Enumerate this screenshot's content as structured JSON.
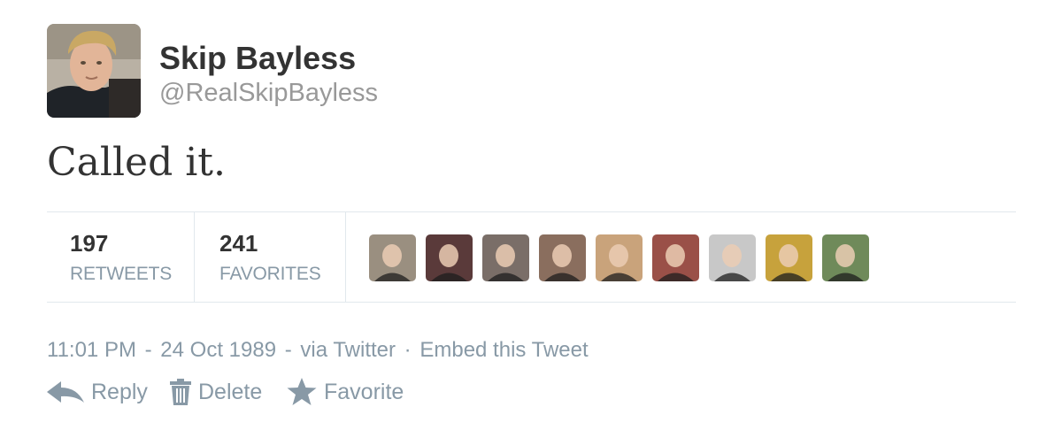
{
  "user": {
    "name": "Skip Bayless",
    "screen_name": "@RealSkipBayless"
  },
  "tweet": {
    "text": "Called it."
  },
  "stats": {
    "retweets_count": "197",
    "retweets_label": "RETWEETS",
    "favorites_count": "241",
    "favorites_label": "FAVORITES"
  },
  "favoriter_avatars": [
    {
      "icon": "favoriter-avatar",
      "bg": "#9a8f80"
    },
    {
      "icon": "favoriter-avatar",
      "bg": "#5a3a3a"
    },
    {
      "icon": "favoriter-avatar",
      "bg": "#7a6e68"
    },
    {
      "icon": "favoriter-avatar",
      "bg": "#8a6e5e"
    },
    {
      "icon": "favoriter-avatar",
      "bg": "#c9a37b"
    },
    {
      "icon": "favoriter-avatar",
      "bg": "#9a5048"
    },
    {
      "icon": "favoriter-avatar",
      "bg": "#c8c8c8"
    },
    {
      "icon": "favoriter-avatar",
      "bg": "#c7a23c"
    },
    {
      "icon": "favoriter-avatar",
      "bg": "#6f8a5a"
    }
  ],
  "meta": {
    "time": "11:01 PM",
    "date": "24 Oct 1989",
    "via": "via Twitter",
    "embed": "Embed this Tweet",
    "dash": "-",
    "dot": "·"
  },
  "actions": {
    "reply": "Reply",
    "delete": "Delete",
    "favorite": "Favorite"
  },
  "colors": {
    "text": "#333333",
    "muted": "#8899a6",
    "border": "#e1e8ed"
  }
}
